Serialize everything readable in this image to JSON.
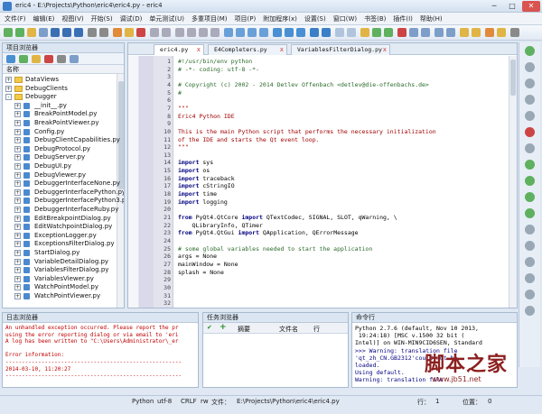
{
  "window": {
    "title": "eric4 - E:\\Projects\\Python\\eric4\\eric4.py - eric4",
    "minimize": "─",
    "maximize": "□",
    "close": "✕"
  },
  "menu": [
    "文件(F)",
    "编辑(E)",
    "视图(V)",
    "开始(S)",
    "调试(D)",
    "单元测试(U)",
    "多重项目(M)",
    "项目(P)",
    "附加程序(x)",
    "设置(S)",
    "窗口(W)",
    "书签(B)",
    "插件(I)",
    "帮助(H)"
  ],
  "project_browser": {
    "title": "项目浏览器",
    "column": "名称",
    "items": [
      {
        "label": "DataViews",
        "type": "folder",
        "indent": 0,
        "expander": "+"
      },
      {
        "label": "DebugClients",
        "type": "folder",
        "indent": 0,
        "expander": "+"
      },
      {
        "label": "Debugger",
        "type": "folder",
        "indent": 0,
        "expander": "-"
      },
      {
        "label": "__init__.py",
        "type": "py",
        "indent": 1,
        "expander": "+"
      },
      {
        "label": "BreakPointModel.py",
        "type": "py",
        "indent": 1,
        "expander": "+"
      },
      {
        "label": "BreakPointViewer.py",
        "type": "py",
        "indent": 1,
        "expander": "+"
      },
      {
        "label": "Config.py",
        "type": "py",
        "indent": 1,
        "expander": "+"
      },
      {
        "label": "DebugClientCapabilities.py",
        "type": "py",
        "indent": 1,
        "expander": "+"
      },
      {
        "label": "DebugProtocol.py",
        "type": "py",
        "indent": 1,
        "expander": "+"
      },
      {
        "label": "DebugServer.py",
        "type": "py",
        "indent": 1,
        "expander": "+"
      },
      {
        "label": "DebugUI.py",
        "type": "py",
        "indent": 1,
        "expander": "+"
      },
      {
        "label": "DebugViewer.py",
        "type": "py",
        "indent": 1,
        "expander": "+"
      },
      {
        "label": "DebuggerInterfaceNone.py",
        "type": "py",
        "indent": 1,
        "expander": "+"
      },
      {
        "label": "DebuggerInterfacePython.py",
        "type": "py",
        "indent": 1,
        "expander": "+"
      },
      {
        "label": "DebuggerInterfacePython3.py",
        "type": "py",
        "indent": 1,
        "expander": "+"
      },
      {
        "label": "DebuggerInterfaceRuby.py",
        "type": "py",
        "indent": 1,
        "expander": "+"
      },
      {
        "label": "EditBreakpointDialog.py",
        "type": "py",
        "indent": 1,
        "expander": "+"
      },
      {
        "label": "EditWatchpointDialog.py",
        "type": "py",
        "indent": 1,
        "expander": "+"
      },
      {
        "label": "ExceptionLogger.py",
        "type": "py",
        "indent": 1,
        "expander": "+"
      },
      {
        "label": "ExceptionsFilterDialog.py",
        "type": "py",
        "indent": 1,
        "expander": "+"
      },
      {
        "label": "StartDialog.py",
        "type": "py",
        "indent": 1,
        "expander": "+"
      },
      {
        "label": "VariableDetailDialog.py",
        "type": "py",
        "indent": 1,
        "expander": "+"
      },
      {
        "label": "VariablesFilterDialog.py",
        "type": "py",
        "indent": 1,
        "expander": "+"
      },
      {
        "label": "VariablesViewer.py",
        "type": "py",
        "indent": 1,
        "expander": "+"
      },
      {
        "label": "WatchPointModel.py",
        "type": "py",
        "indent": 1,
        "expander": "+"
      },
      {
        "label": "WatchPointViewer.py",
        "type": "py",
        "indent": 1,
        "expander": "+"
      }
    ]
  },
  "editor": {
    "tabs": [
      {
        "label": "eric4.py",
        "active": true
      },
      {
        "label": "E4Completers.py",
        "active": false
      },
      {
        "label": "VariablesFilterDialog.py",
        "active": false
      }
    ],
    "tab_close": "x",
    "lines": [
      {
        "n": "1",
        "text": "#!/usr/bin/env python",
        "cls": "c-comment"
      },
      {
        "n": "2",
        "text": "# -*- coding: utf-8 -*-",
        "cls": "c-comment"
      },
      {
        "n": "3",
        "text": "",
        "cls": ""
      },
      {
        "n": "4",
        "text": "# Copyright (c) 2002 - 2014 Detlev Offenbach <detlev@die-offenbachs.de>",
        "cls": "c-comment"
      },
      {
        "n": "5",
        "text": "#",
        "cls": "c-comment"
      },
      {
        "n": "6",
        "text": "",
        "cls": ""
      },
      {
        "n": "7",
        "text": "\"\"\"",
        "cls": "c-doc"
      },
      {
        "n": "8",
        "text": "Eric4 Python IDE",
        "cls": "c-doc"
      },
      {
        "n": "9",
        "text": "",
        "cls": ""
      },
      {
        "n": "10",
        "text": "This is the main Python script that performs the necessary initialization",
        "cls": "c-doc"
      },
      {
        "n": "11",
        "text": "of the IDE and starts the Qt event loop.",
        "cls": "c-doc"
      },
      {
        "n": "12",
        "text": "\"\"\"",
        "cls": "c-doc"
      },
      {
        "n": "13",
        "text": "",
        "cls": ""
      },
      {
        "n": "14",
        "text": "import sys",
        "cls": "kw"
      },
      {
        "n": "15",
        "text": "import os",
        "cls": "kw"
      },
      {
        "n": "16",
        "text": "import traceback",
        "cls": "kw"
      },
      {
        "n": "17",
        "text": "import cStringIO",
        "cls": "kw"
      },
      {
        "n": "18",
        "text": "import time",
        "cls": "kw"
      },
      {
        "n": "19",
        "text": "import logging",
        "cls": "kw"
      },
      {
        "n": "20",
        "text": "",
        "cls": ""
      },
      {
        "n": "21",
        "text": "from PyQt4.QtCore import QTextCodec, SIGNAL, SLOT, qWarning, \\",
        "cls": "kw"
      },
      {
        "n": "22",
        "text": "    QLibraryInfo, QTimer",
        "cls": ""
      },
      {
        "n": "23",
        "text": "from PyQt4.QtGui import QApplication, QErrorMessage",
        "cls": "kw"
      },
      {
        "n": "24",
        "text": "",
        "cls": ""
      },
      {
        "n": "25",
        "text": "# some global variables needed to start the application",
        "cls": "c-comment"
      },
      {
        "n": "26",
        "text": "args = None",
        "cls": ""
      },
      {
        "n": "27",
        "text": "mainWindow = None",
        "cls": ""
      },
      {
        "n": "28",
        "text": "splash = None",
        "cls": ""
      },
      {
        "n": "29",
        "text": "",
        "cls": ""
      },
      {
        "n": "30",
        "text": "",
        "cls": ""
      },
      {
        "n": "31",
        "text": "",
        "cls": ""
      },
      {
        "n": "32",
        "text": "",
        "cls": ""
      }
    ]
  },
  "log_viewer": {
    "title": "日志浏览器",
    "lines": [
      "An unhandled exception occurred. Please report the pr",
      "using the error reporting dialog or via email to 'eri",
      "A log has been written to \"C:\\Users\\Administrator\\_er",
      "",
      "Error information:",
      "------------------------------------------------------",
      "2014-03-10, 11:20:27",
      "------------------------------------------------------",
      ""
    ]
  },
  "task_viewer": {
    "title": "任务浏览器",
    "columns": [
      "摘要",
      "文件名",
      "行"
    ]
  },
  "shell": {
    "title": "命令行",
    "lines": [
      "Python 2.7.6 (default, Nov 10 2013,",
      " 19:24:18) [MSC v.1500 32 bit (",
      "Intel)] on WIN-MIN9CID6SEN, Standard",
      ">>> Warning: translation file",
      "'qt_zh_CN.GB2312'could not be",
      "loaded.",
      "Using default.",
      "Warning: translation file"
    ]
  },
  "statusbar": {
    "python": "Python",
    "encoding": "utf-8",
    "eol": "CRLF",
    "mode": "rw",
    "file_label": "文件：",
    "file": "E:\\Projects\\Python\\eric4\\eric4.py",
    "line_label": "行：",
    "line": "1",
    "pos_label": "位置：",
    "pos": "0"
  },
  "watermark": {
    "text": "脚本之家",
    "url": "www.jb51.net"
  },
  "colors": {
    "accent": "#3a7ec8",
    "comment": "#2a6a2a",
    "docstring": "#a00000",
    "keyword": "#000080"
  }
}
